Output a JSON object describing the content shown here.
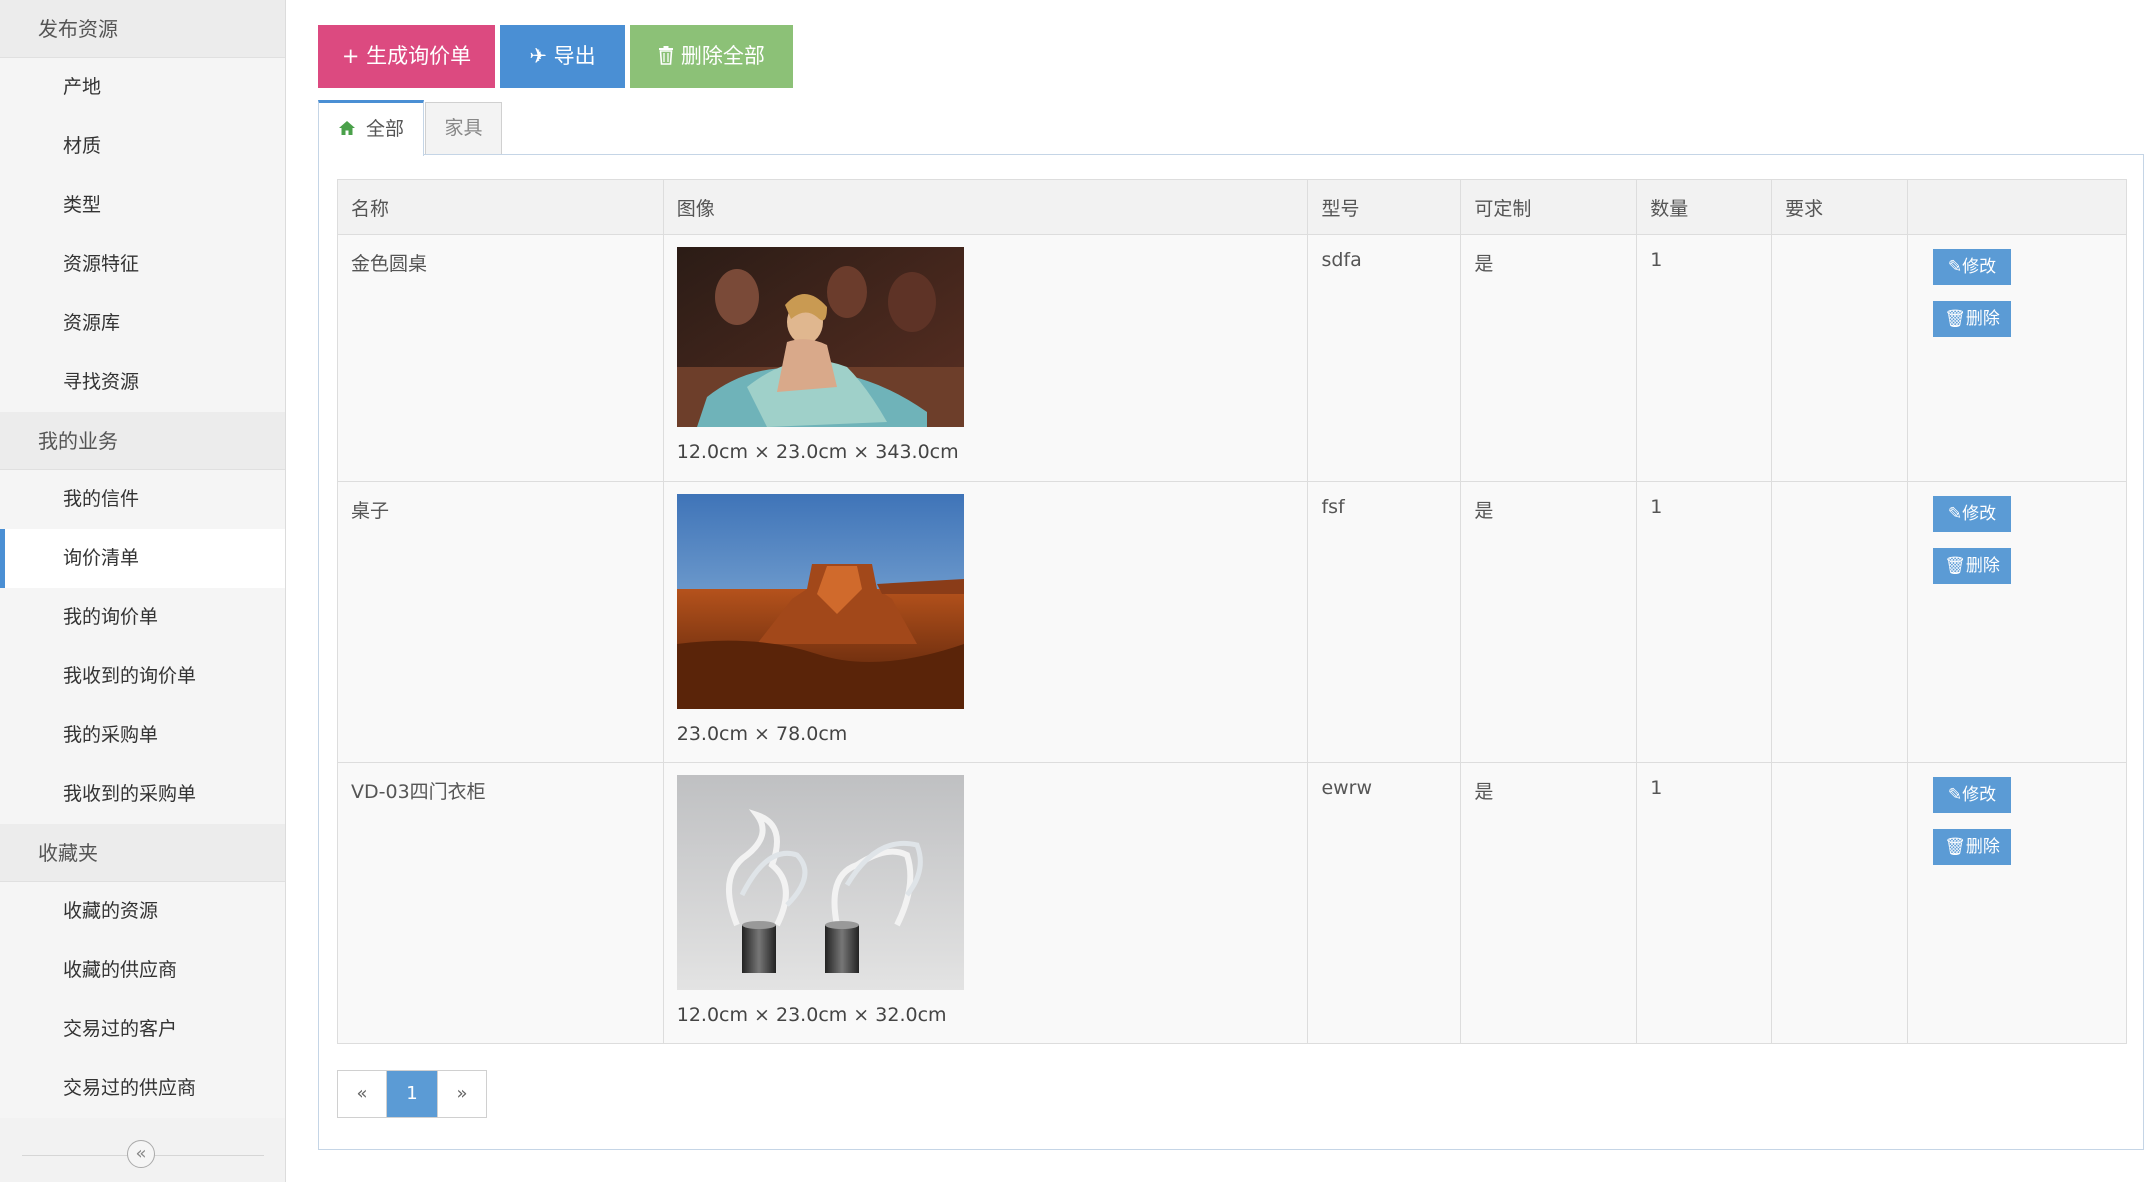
{
  "sidebar": {
    "groups": [
      {
        "title": "发布资源",
        "items": [
          "产地",
          "材质",
          "类型",
          "资源特征",
          "资源库",
          "寻找资源"
        ]
      },
      {
        "title": "我的业务",
        "items": [
          "我的信件",
          "询价清单",
          "我的询价单",
          "我收到的询价单",
          "我的采购单",
          "我收到的采购单"
        ]
      },
      {
        "title": "收藏夹",
        "items": [
          "收藏的资源",
          "收藏的供应商",
          "交易过的客户",
          "交易过的供应商"
        ]
      }
    ],
    "active_item": "询价清单",
    "collapse_glyph": "«"
  },
  "toolbar": {
    "generate_icon": "+",
    "generate_label": "生成询价单",
    "export_icon": "✈",
    "export_label": "导出",
    "delete_all_icon": "🗑",
    "delete_all_label": "删除全部"
  },
  "tabs": [
    {
      "label": "全部",
      "icon": "home-icon",
      "active": true
    },
    {
      "label": "家具",
      "active": false
    }
  ],
  "table": {
    "headers": [
      "名称",
      "图像",
      "型号",
      "可定制",
      "数量",
      "要求",
      ""
    ],
    "rows": [
      {
        "name": "金色圆桌",
        "image": "painting-thumbnail",
        "dims": "12.0cm × 23.0cm × 343.0cm",
        "model": "sdfa",
        "customizable": "是",
        "qty": "1",
        "req": "",
        "edit": "修改",
        "delete": "删除"
      },
      {
        "name": "桌子",
        "image": "desert-mesa-thumbnail",
        "dims": "23.0cm × 78.0cm",
        "model": "fsf",
        "customizable": "是",
        "qty": "1",
        "req": "",
        "edit": "修改",
        "delete": "删除"
      },
      {
        "name": "VD-03四门衣柜",
        "image": "crystal-sculpture-thumbnail",
        "dims": "12.0cm × 23.0cm × 32.0cm",
        "model": "ewrw",
        "customizable": "是",
        "qty": "1",
        "req": "",
        "edit": "修改",
        "delete": "删除"
      }
    ]
  },
  "pagination": {
    "prev": "«",
    "current": "1",
    "next": "»"
  },
  "colors": {
    "pink": "#dc4a80",
    "blue": "#4a8fd4",
    "green": "#8cc177",
    "action_blue": "#5b9bd5"
  }
}
